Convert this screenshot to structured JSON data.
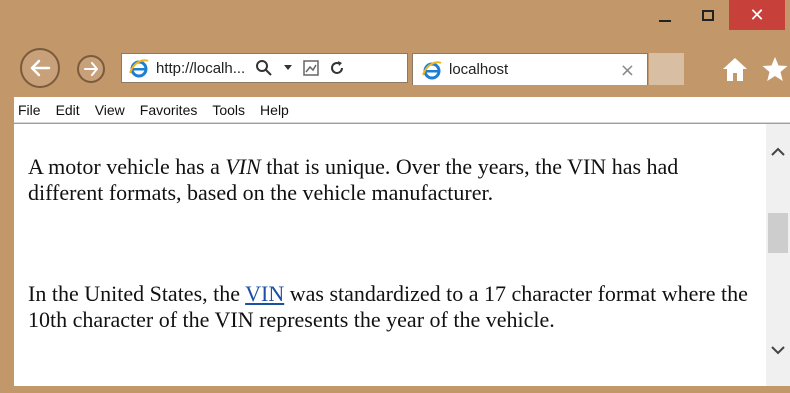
{
  "window": {
    "close_glyph": "✕",
    "frame_color": "#c2976a"
  },
  "address_bar": {
    "url": "http://localh...",
    "icon": "ie-logo-icon"
  },
  "tab": {
    "title": "localhost",
    "close_glyph": "×"
  },
  "menu": {
    "items": [
      "File",
      "Edit",
      "View",
      "Favorites",
      "Tools",
      "Help"
    ]
  },
  "content": {
    "p1_a": "A motor vehicle has a ",
    "p1_em": "VIN",
    "p1_b": " that is unique. Over the years, the VIN has had different formats, based on the vehicle manufacturer.",
    "p2_a": "In the United States, the ",
    "p2_link": "VIN",
    "p2_b": " was standardized to a 17 character format where the 10th character of the VIN represents the year of the vehicle."
  }
}
